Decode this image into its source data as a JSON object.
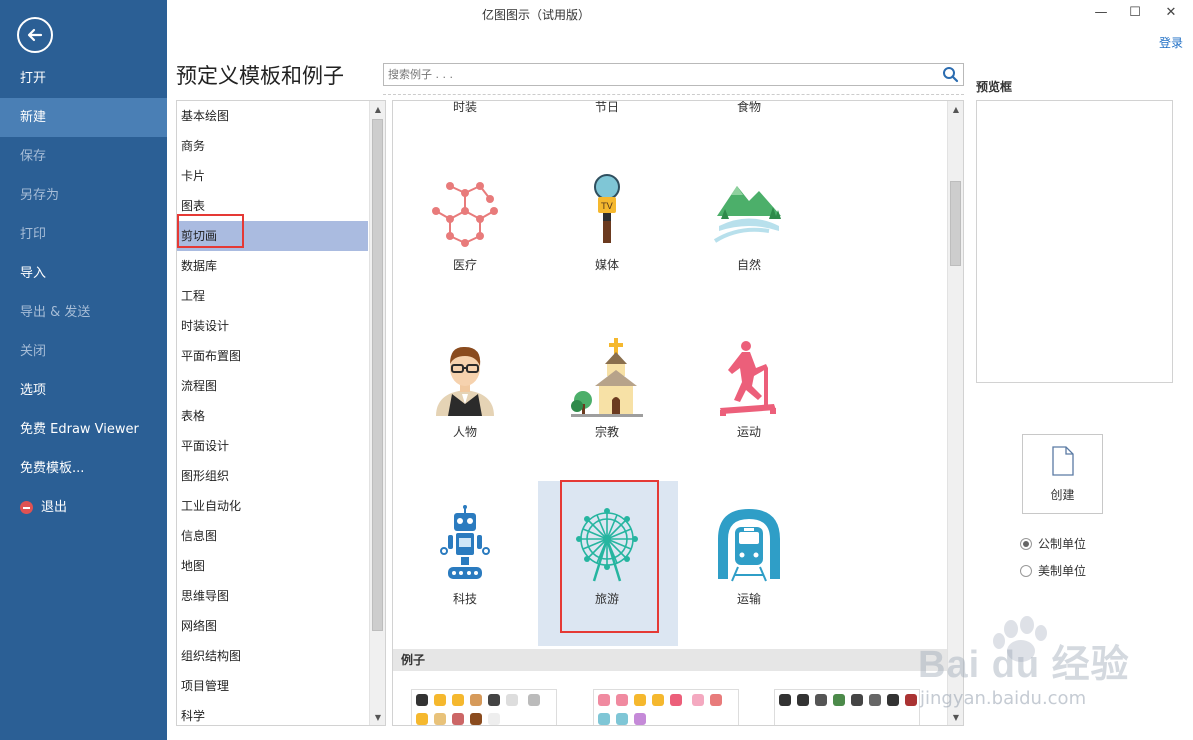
{
  "window": {
    "title": "亿图图示（试用版）",
    "minimize_glyph": "—",
    "maximize_glyph": "☐",
    "close_glyph": "✕",
    "login": "登录"
  },
  "sidebar": {
    "items": [
      {
        "label": "打开",
        "state": "normal"
      },
      {
        "label": "新建",
        "state": "active"
      },
      {
        "label": "保存",
        "state": "dim"
      },
      {
        "label": "另存为",
        "state": "dim"
      },
      {
        "label": "打印",
        "state": "dim"
      },
      {
        "label": "导入",
        "state": "normal"
      },
      {
        "label": "导出 & 发送",
        "state": "dim"
      },
      {
        "label": "关闭",
        "state": "dim"
      },
      {
        "label": "选项",
        "state": "normal"
      },
      {
        "label": "免费 Edraw Viewer",
        "state": "normal"
      },
      {
        "label": "免费模板...",
        "state": "normal"
      },
      {
        "label": "退出",
        "state": "normal"
      }
    ]
  },
  "header": {
    "title": "预定义模板和例子",
    "search_placeholder": "搜索例子 . . ."
  },
  "categories": [
    "基本绘图",
    "商务",
    "卡片",
    "图表",
    "剪切画",
    "数据库",
    "工程",
    "时装设计",
    "平面布置图",
    "流程图",
    "表格",
    "平面设计",
    "图形组织",
    "工业自动化",
    "信息图",
    "地图",
    "思维导图",
    "网络图",
    "组织结构图",
    "项目管理",
    "科学"
  ],
  "selected_category": "剪切画",
  "top_cut_labels": [
    "时装",
    "节日",
    "食物"
  ],
  "templates": [
    {
      "label": "医疗",
      "icon": "molecule-icon"
    },
    {
      "label": "媒体",
      "icon": "tv-microphone-icon"
    },
    {
      "label": "自然",
      "icon": "mountain-landscape-icon"
    },
    {
      "label": "人物",
      "icon": "man-with-glasses-icon"
    },
    {
      "label": "宗教",
      "icon": "church-icon"
    },
    {
      "label": "运动",
      "icon": "treadmill-runner-icon"
    },
    {
      "label": "科技",
      "icon": "robot-icon"
    },
    {
      "label": "旅游",
      "icon": "ferris-wheel-icon"
    },
    {
      "label": "运输",
      "icon": "subway-train-icon"
    }
  ],
  "selected_template": "旅游",
  "examples_label": "例子",
  "preview": {
    "label": "预览框",
    "create_label": "创建",
    "units": [
      {
        "label": "公制单位",
        "checked": true
      },
      {
        "label": "美制单位",
        "checked": false
      }
    ]
  },
  "watermark": {
    "brand": "Bai du 经验",
    "url": "jingyan.baidu.com"
  },
  "colors": {
    "sidebar_bg": "#2b5f95",
    "sidebar_active": "#4a7fb5",
    "selection": "#aabbe0",
    "tile_selected": "#dce6f2",
    "highlight_box": "#e53935"
  }
}
